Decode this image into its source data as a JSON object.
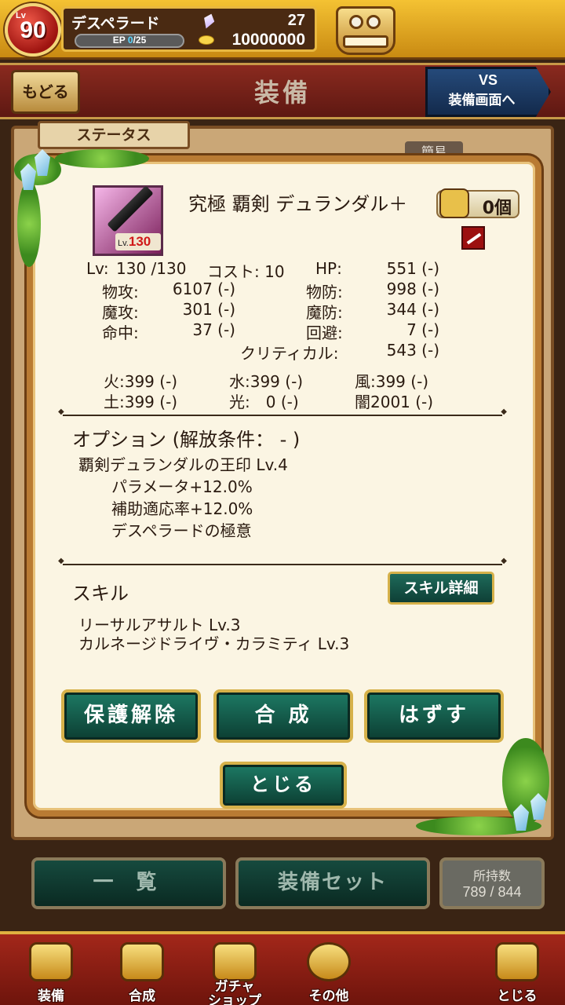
{
  "header": {
    "level_label": "Lv",
    "level": "90",
    "player_name": "デスペラード",
    "ep_label": "EP",
    "ep_current": "0",
    "ep_max": "/25",
    "gems": "27",
    "coins": "10000000"
  },
  "titlebar": {
    "back_label": "もどる",
    "title": "装備",
    "vs_top": "VS",
    "vs_bottom": "装備画面へ"
  },
  "tabs": {
    "status": "ステータス",
    "simple": "簡易"
  },
  "item": {
    "name": "究極 覇剣 デュランダル＋",
    "icon_lv_label": "Lv.",
    "icon_lv": "130",
    "owned_count": "0個"
  },
  "stats": {
    "lv_label": "Lv:",
    "lv_value": "130 /130",
    "cost": "コスト: 10",
    "hp_label": "HP:",
    "hp_value": "551 (-)",
    "patk_label": "物攻:",
    "patk_value": "6107 (-)",
    "pdef_label": "物防:",
    "pdef_value": "998 (-)",
    "matk_label": "魔攻:",
    "matk_value": "301 (-)",
    "mdef_label": "魔防:",
    "mdef_value": "344 (-)",
    "hit_label": "命中:",
    "hit_value": "37 (-)",
    "eva_label": "回避:",
    "eva_value": "7 (-)",
    "crit_label": "クリティカル:",
    "crit_value": "543 (-)"
  },
  "elements": {
    "fire": "火:399 (-)",
    "water": "水:399 (-)",
    "wind": "風:399 (-)",
    "earth": "土:399 (-)",
    "light": "光:　0 (-)",
    "dark": "闇2001 (-)"
  },
  "option": {
    "title": "オプション (解放条件： - )",
    "lines": [
      "覇剣デュランダルの王印 Lv.4",
      "パラメータ+12.0%",
      "補助適応率+12.0%",
      "デスペラードの極意"
    ]
  },
  "skill": {
    "title": "スキル",
    "detail_button": "スキル詳細",
    "lines": [
      "リーサルアサルト  Lv.3",
      "カルネージドライヴ・カラミティ  Lv.3"
    ]
  },
  "actions": {
    "unprotect": "保護解除",
    "merge": "合 成",
    "remove": "はずす",
    "close": "とじる"
  },
  "footer": {
    "list": "一 覧",
    "set": "装備セット",
    "owned_label": "所持数",
    "owned_value": "789 / 844"
  },
  "nav": {
    "equip": "装備",
    "merge": "合成",
    "gacha_1": "ガチャ",
    "gacha_2": "ショップ",
    "other": "その他",
    "close": "とじる"
  }
}
